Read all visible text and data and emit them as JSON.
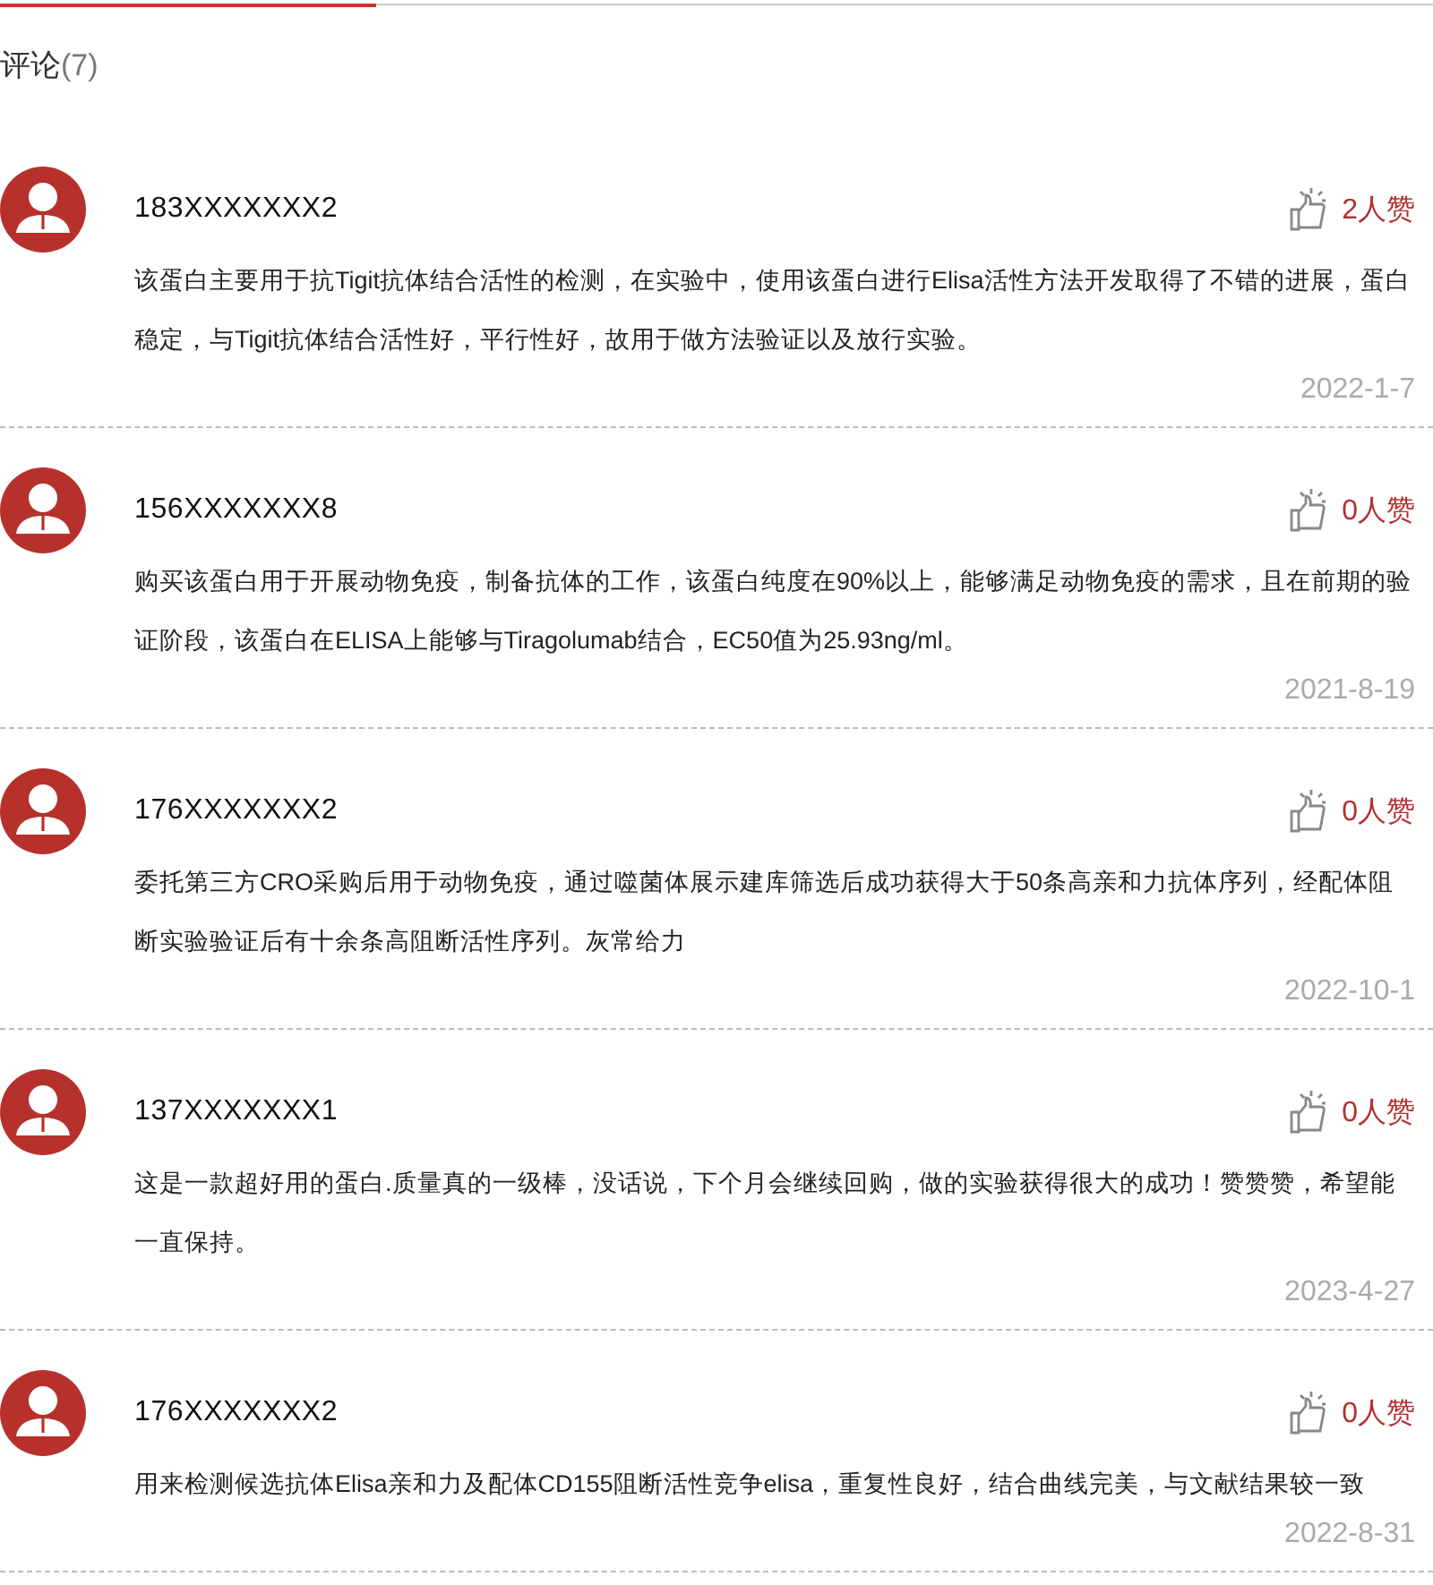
{
  "header": {
    "title": "评论",
    "count": "(7)"
  },
  "comments": [
    {
      "user": "183XXXXXXX2",
      "likes": "2人赞",
      "text": "该蛋白主要用于抗Tigit抗体结合活性的检测，在实验中，使用该蛋白进行Elisa活性方法开发取得了不错的进展，蛋白稳定，与Tigit抗体结合活性好，平行性好，故用于做方法验证以及放行实验。",
      "date": "2022-1-7"
    },
    {
      "user": "156XXXXXXX8",
      "likes": "0人赞",
      "text": "购买该蛋白用于开展动物免疫，制备抗体的工作，该蛋白纯度在90%以上，能够满足动物免疫的需求，且在前期的验证阶段，该蛋白在ELISA上能够与Tiragolumab结合，EC50值为25.93ng/ml。",
      "date": "2021-8-19"
    },
    {
      "user": "176XXXXXXX2",
      "likes": "0人赞",
      "text": "委托第三方CRO采购后用于动物免疫，通过噬菌体展示建库筛选后成功获得大于50条高亲和力抗体序列，经配体阻断实验验证后有十余条高阻断活性序列。灰常给力",
      "date": "2022-10-1"
    },
    {
      "user": "137XXXXXXX1",
      "likes": "0人赞",
      "text": "这是一款超好用的蛋白.质量真的一级棒，没话说，下个月会继续回购，做的实验获得很大的成功！赞赞赞，希望能一直保持。",
      "date": "2023-4-27"
    },
    {
      "user": "176XXXXXXX2",
      "likes": "0人赞",
      "text": "用来检测候选抗体Elisa亲和力及配体CD155阻断活性竞争elisa，重复性良好，结合曲线完美，与文献结果较一致",
      "date": "2022-8-31"
    }
  ]
}
